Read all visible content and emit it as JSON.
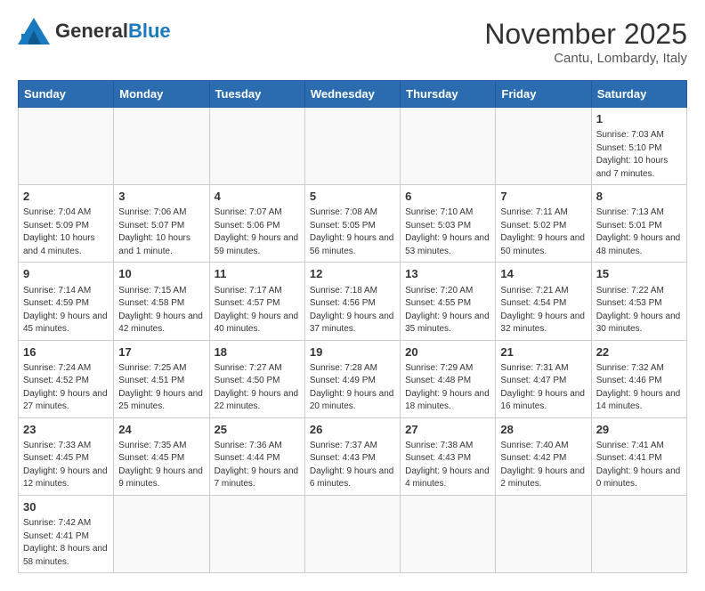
{
  "header": {
    "logo_general": "General",
    "logo_blue": "Blue",
    "month_title": "November 2025",
    "location": "Cantu, Lombardy, Italy"
  },
  "weekdays": [
    "Sunday",
    "Monday",
    "Tuesday",
    "Wednesday",
    "Thursday",
    "Friday",
    "Saturday"
  ],
  "weeks": [
    [
      {
        "day": "",
        "info": ""
      },
      {
        "day": "",
        "info": ""
      },
      {
        "day": "",
        "info": ""
      },
      {
        "day": "",
        "info": ""
      },
      {
        "day": "",
        "info": ""
      },
      {
        "day": "",
        "info": ""
      },
      {
        "day": "1",
        "info": "Sunrise: 7:03 AM\nSunset: 5:10 PM\nDaylight: 10 hours and 7 minutes."
      }
    ],
    [
      {
        "day": "2",
        "info": "Sunrise: 7:04 AM\nSunset: 5:09 PM\nDaylight: 10 hours and 4 minutes."
      },
      {
        "day": "3",
        "info": "Sunrise: 7:06 AM\nSunset: 5:07 PM\nDaylight: 10 hours and 1 minute."
      },
      {
        "day": "4",
        "info": "Sunrise: 7:07 AM\nSunset: 5:06 PM\nDaylight: 9 hours and 59 minutes."
      },
      {
        "day": "5",
        "info": "Sunrise: 7:08 AM\nSunset: 5:05 PM\nDaylight: 9 hours and 56 minutes."
      },
      {
        "day": "6",
        "info": "Sunrise: 7:10 AM\nSunset: 5:03 PM\nDaylight: 9 hours and 53 minutes."
      },
      {
        "day": "7",
        "info": "Sunrise: 7:11 AM\nSunset: 5:02 PM\nDaylight: 9 hours and 50 minutes."
      },
      {
        "day": "8",
        "info": "Sunrise: 7:13 AM\nSunset: 5:01 PM\nDaylight: 9 hours and 48 minutes."
      }
    ],
    [
      {
        "day": "9",
        "info": "Sunrise: 7:14 AM\nSunset: 4:59 PM\nDaylight: 9 hours and 45 minutes."
      },
      {
        "day": "10",
        "info": "Sunrise: 7:15 AM\nSunset: 4:58 PM\nDaylight: 9 hours and 42 minutes."
      },
      {
        "day": "11",
        "info": "Sunrise: 7:17 AM\nSunset: 4:57 PM\nDaylight: 9 hours and 40 minutes."
      },
      {
        "day": "12",
        "info": "Sunrise: 7:18 AM\nSunset: 4:56 PM\nDaylight: 9 hours and 37 minutes."
      },
      {
        "day": "13",
        "info": "Sunrise: 7:20 AM\nSunset: 4:55 PM\nDaylight: 9 hours and 35 minutes."
      },
      {
        "day": "14",
        "info": "Sunrise: 7:21 AM\nSunset: 4:54 PM\nDaylight: 9 hours and 32 minutes."
      },
      {
        "day": "15",
        "info": "Sunrise: 7:22 AM\nSunset: 4:53 PM\nDaylight: 9 hours and 30 minutes."
      }
    ],
    [
      {
        "day": "16",
        "info": "Sunrise: 7:24 AM\nSunset: 4:52 PM\nDaylight: 9 hours and 27 minutes."
      },
      {
        "day": "17",
        "info": "Sunrise: 7:25 AM\nSunset: 4:51 PM\nDaylight: 9 hours and 25 minutes."
      },
      {
        "day": "18",
        "info": "Sunrise: 7:27 AM\nSunset: 4:50 PM\nDaylight: 9 hours and 22 minutes."
      },
      {
        "day": "19",
        "info": "Sunrise: 7:28 AM\nSunset: 4:49 PM\nDaylight: 9 hours and 20 minutes."
      },
      {
        "day": "20",
        "info": "Sunrise: 7:29 AM\nSunset: 4:48 PM\nDaylight: 9 hours and 18 minutes."
      },
      {
        "day": "21",
        "info": "Sunrise: 7:31 AM\nSunset: 4:47 PM\nDaylight: 9 hours and 16 minutes."
      },
      {
        "day": "22",
        "info": "Sunrise: 7:32 AM\nSunset: 4:46 PM\nDaylight: 9 hours and 14 minutes."
      }
    ],
    [
      {
        "day": "23",
        "info": "Sunrise: 7:33 AM\nSunset: 4:45 PM\nDaylight: 9 hours and 12 minutes."
      },
      {
        "day": "24",
        "info": "Sunrise: 7:35 AM\nSunset: 4:45 PM\nDaylight: 9 hours and 9 minutes."
      },
      {
        "day": "25",
        "info": "Sunrise: 7:36 AM\nSunset: 4:44 PM\nDaylight: 9 hours and 7 minutes."
      },
      {
        "day": "26",
        "info": "Sunrise: 7:37 AM\nSunset: 4:43 PM\nDaylight: 9 hours and 6 minutes."
      },
      {
        "day": "27",
        "info": "Sunrise: 7:38 AM\nSunset: 4:43 PM\nDaylight: 9 hours and 4 minutes."
      },
      {
        "day": "28",
        "info": "Sunrise: 7:40 AM\nSunset: 4:42 PM\nDaylight: 9 hours and 2 minutes."
      },
      {
        "day": "29",
        "info": "Sunrise: 7:41 AM\nSunset: 4:41 PM\nDaylight: 9 hours and 0 minutes."
      }
    ],
    [
      {
        "day": "30",
        "info": "Sunrise: 7:42 AM\nSunset: 4:41 PM\nDaylight: 8 hours and 58 minutes."
      },
      {
        "day": "",
        "info": ""
      },
      {
        "day": "",
        "info": ""
      },
      {
        "day": "",
        "info": ""
      },
      {
        "day": "",
        "info": ""
      },
      {
        "day": "",
        "info": ""
      },
      {
        "day": "",
        "info": ""
      }
    ]
  ]
}
